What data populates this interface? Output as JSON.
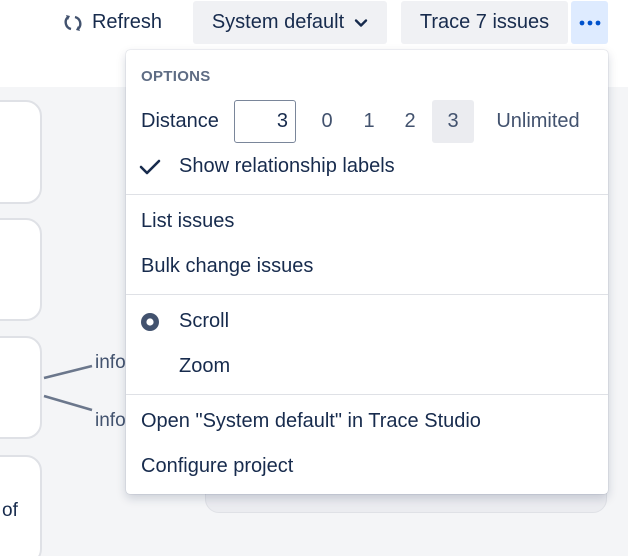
{
  "toolbar": {
    "refresh_label": "Refresh",
    "refresh_icon": "refresh-icon",
    "view_label": "System default",
    "view_icon": "chevron-down-icon",
    "trace_label": "Trace 7 issues",
    "more_icon": "more-horizontal-icon"
  },
  "canvas": {
    "edge_labels": [
      "info",
      "info"
    ],
    "partial_node_text": "of"
  },
  "menu": {
    "heading": "OPTIONS",
    "distance": {
      "label": "Distance",
      "value": "3",
      "options": [
        "0",
        "1",
        "2",
        "3",
        "Unlimited"
      ],
      "selected": "3"
    },
    "show_labels": {
      "label": "Show relationship labels",
      "checked": true
    },
    "actions": [
      "List issues",
      "Bulk change issues"
    ],
    "mode": {
      "options": [
        "Scroll",
        "Zoom"
      ],
      "selected": "Scroll"
    },
    "links": [
      "Open \"System default\" in Trace Studio",
      "Configure project"
    ]
  },
  "colors": {
    "text": "#172b4d",
    "accent": "#0052cc",
    "selected_bg": "#deebff",
    "button_bg": "#f0f1f4",
    "radio": "#42526e"
  }
}
